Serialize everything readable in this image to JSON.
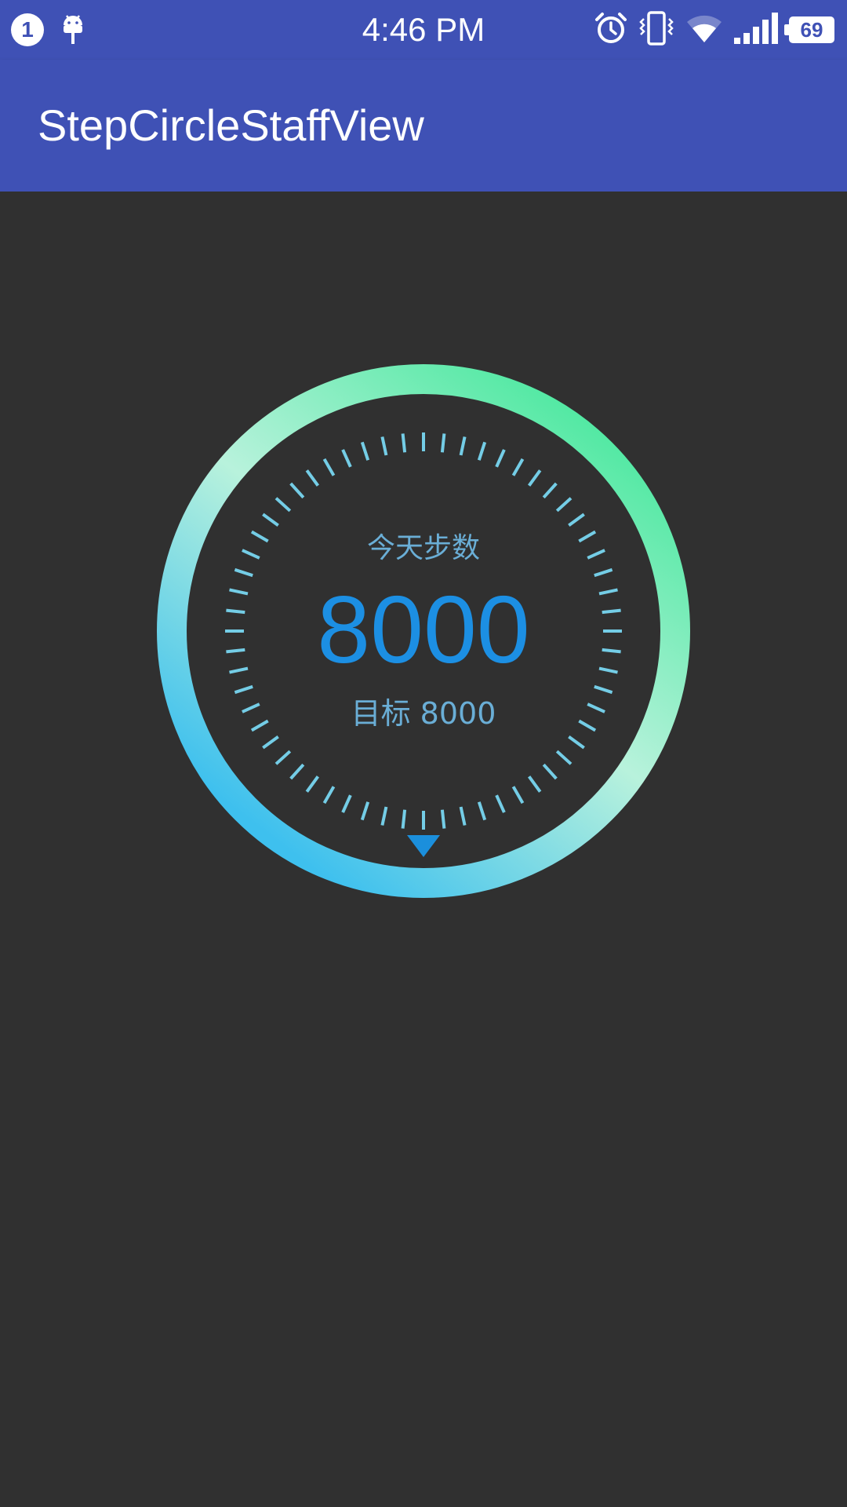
{
  "status_bar": {
    "notification_count": "1",
    "time": "4:46 PM",
    "battery_level": "69",
    "icons": [
      "android-debug-icon",
      "alarm-icon",
      "vibrate-icon",
      "wifi-icon",
      "signal-icon",
      "battery-icon"
    ]
  },
  "app_bar": {
    "title": "StepCircleStaffView"
  },
  "step_dial": {
    "today_label": "今天步数",
    "step_count": "8000",
    "target_label": "目标 8000",
    "progress_fraction": 1.0,
    "colors": {
      "ring_start": "#3ec0ee",
      "ring_mid": "#b8f2dc",
      "ring_end": "#4de8a0",
      "tick": "#74cde6",
      "count": "#1c8fe3",
      "label": "#6aaed6",
      "pointer": "#1b8fdc"
    }
  }
}
